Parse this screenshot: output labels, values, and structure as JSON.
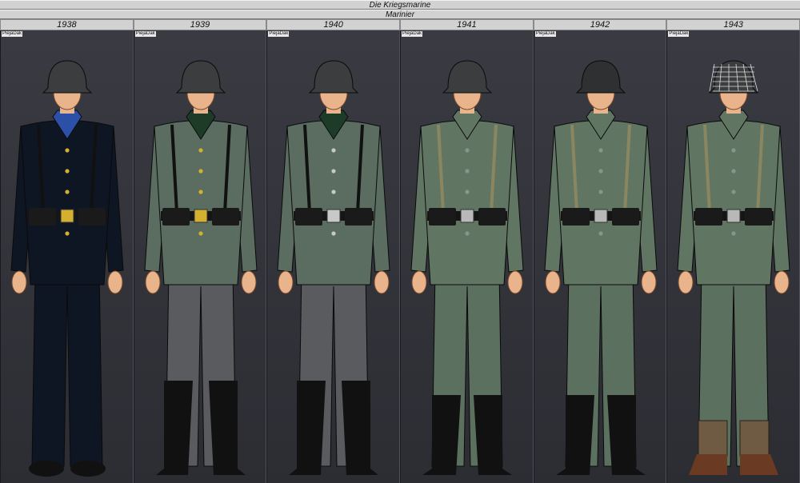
{
  "header": {
    "title": "Die Kriegsmarine",
    "subtitle": "Marinier"
  },
  "columns": [
    {
      "year": "1938",
      "credit": "PiejaDak",
      "variant": {
        "tunic": "#0f1623",
        "trousers": "#0f1623",
        "helmet": "#3c3d3e",
        "collar": "#2c50a8",
        "buttons": "#d4b030",
        "belt_buckle": "#d4b030",
        "boots": "shoes",
        "straps": "#111111",
        "helmet_net": false
      }
    },
    {
      "year": "1939",
      "credit": "PiejaDak",
      "variant": {
        "tunic": "#5a6d60",
        "trousers": "#5a5b5f",
        "helmet": "#3c3d3e",
        "collar": "#1e3b28",
        "buttons": "#d4b030",
        "belt_buckle": "#d4b030",
        "boots": "jackboots",
        "straps": "#111111",
        "helmet_net": false
      }
    },
    {
      "year": "1940",
      "credit": "PiejaDak",
      "variant": {
        "tunic": "#5a6d60",
        "trousers": "#5a5b5f",
        "helmet": "#3c3d3e",
        "collar": "#1e3b28",
        "buttons": "#c8c8c8",
        "belt_buckle": "#c8c8c8",
        "boots": "jackboots",
        "straps": "#111111",
        "helmet_net": false
      }
    },
    {
      "year": "1941",
      "credit": "PiejaDak",
      "variant": {
        "tunic": "#607663",
        "trousers": "#5c705f",
        "helmet": "#3c3d3e",
        "collar": "#607663",
        "buttons": "#8a948c",
        "belt_buckle": "#b8b8b8",
        "boots": "ankle-boots",
        "straps": "#8a8660",
        "helmet_net": false
      }
    },
    {
      "year": "1942",
      "credit": "PiejaDak",
      "variant": {
        "tunic": "#607663",
        "trousers": "#5c705f",
        "helmet": "#2f3031",
        "collar": "#607663",
        "buttons": "#8a948c",
        "belt_buckle": "#b8b8b8",
        "boots": "ankle-boots",
        "straps": "#8a8660",
        "helmet_net": false
      }
    },
    {
      "year": "1943",
      "credit": "PiejaDak",
      "variant": {
        "tunic": "#607663",
        "trousers": "#5c705f",
        "helmet": "#3c3d3e",
        "collar": "#607663",
        "buttons": "#8a948c",
        "belt_buckle": "#b8b8b8",
        "boots": "gaiters",
        "straps": "#8a8660",
        "helmet_net": true
      }
    }
  ]
}
